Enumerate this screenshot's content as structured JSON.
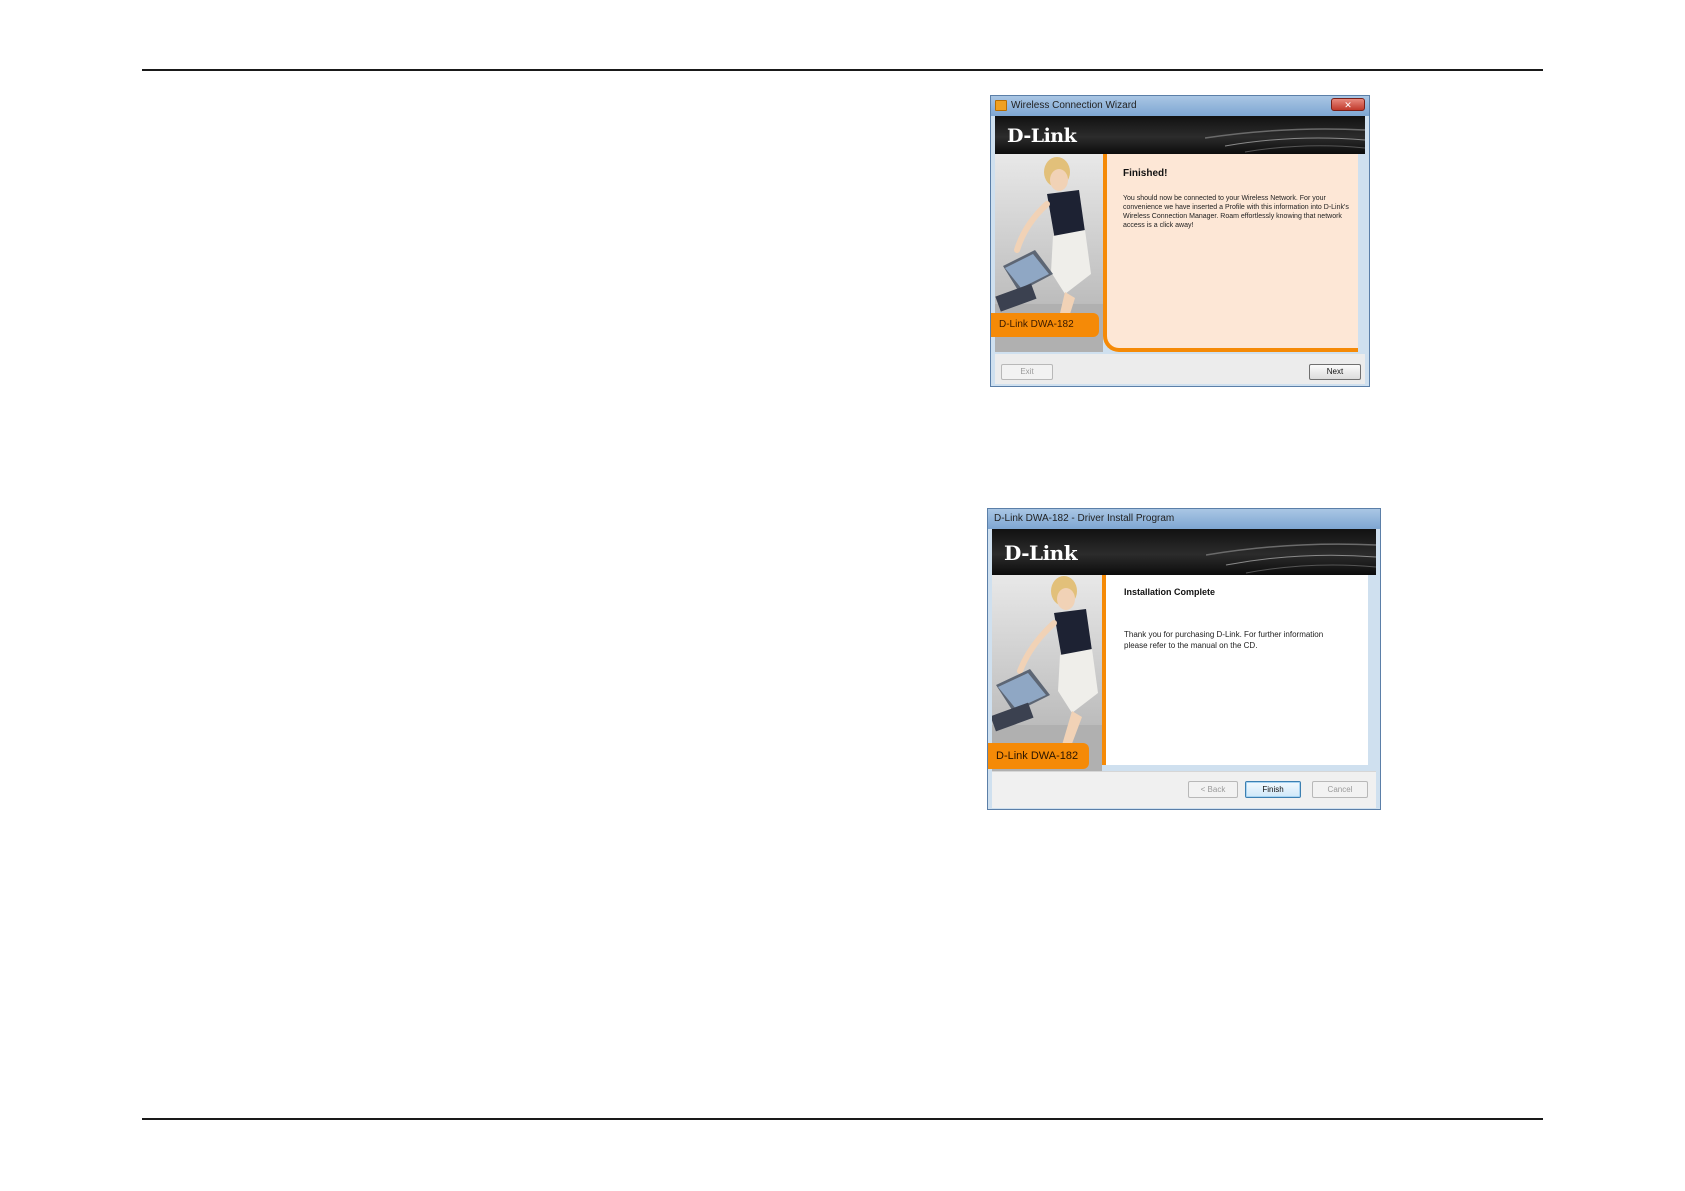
{
  "window1": {
    "title": "Wireless Connection Wizard",
    "logo": "D-Link",
    "model_label": "D-Link DWA-182",
    "heading": "Finished!",
    "body": "You should now be connected to your Wireless Network. For your convenience we have inserted a Profile with this information into D-Link's Wireless Connection Manager. Roam effortlessly knowing that network access is a click away!",
    "buttons": {
      "exit": "Exit",
      "next": "Next"
    }
  },
  "window2": {
    "title": "D-Link DWA-182 - Driver Install Program",
    "logo": "D-Link",
    "model_label": "D-Link DWA-182",
    "heading": "Installation Complete",
    "body": "Thank you for purchasing D-Link. For further information please refer to the manual on the CD.",
    "buttons": {
      "back": "< Back",
      "finish": "Finish",
      "cancel": "Cancel"
    }
  },
  "colors": {
    "accent_orange": "#f58a07",
    "wizard_panel": "#fde7d6",
    "banner": "#1a1a1a",
    "titlebar": "#7ea6d2"
  }
}
